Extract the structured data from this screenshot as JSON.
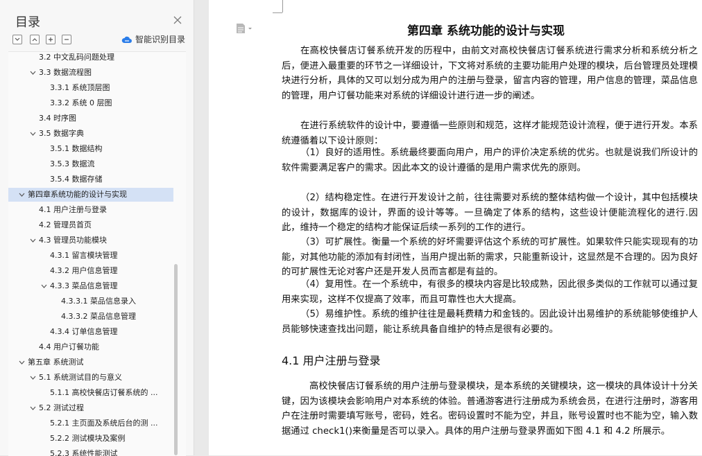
{
  "sidebar": {
    "title": "目录",
    "smart_toc_label": "智能识别目录",
    "items": [
      {
        "label": "3.2 中文乱码问题处理",
        "level": 2,
        "arrow": false,
        "selected": false
      },
      {
        "label": "3.3 数据流程图",
        "level": 2,
        "arrow": true,
        "selected": false
      },
      {
        "label": "3.3.1 系统顶层图",
        "level": 3,
        "arrow": false,
        "selected": false
      },
      {
        "label": "3.3.2 系统 0 层图",
        "level": 3,
        "arrow": false,
        "selected": false
      },
      {
        "label": "3.4 时序图",
        "level": 2,
        "arrow": false,
        "selected": false
      },
      {
        "label": "3.5  数据字典",
        "level": 2,
        "arrow": true,
        "selected": false
      },
      {
        "label": "3.5.1  数据结构",
        "level": 3,
        "arrow": false,
        "selected": false
      },
      {
        "label": "3.5.3  数据流",
        "level": 3,
        "arrow": false,
        "selected": false
      },
      {
        "label": "3.5.4 数据存储",
        "level": 3,
        "arrow": false,
        "selected": false
      },
      {
        "label": "第四章系统功能的设计与实现",
        "level": 1,
        "arrow": true,
        "selected": true
      },
      {
        "label": "4.1 用户注册与登录",
        "level": 2,
        "arrow": false,
        "selected": false
      },
      {
        "label": "4.2 管理员首页",
        "level": 2,
        "arrow": false,
        "selected": false
      },
      {
        "label": "4.3 管理员功能模块",
        "level": 2,
        "arrow": true,
        "selected": false
      },
      {
        "label": "4.3.1 留言模块管理",
        "level": 3,
        "arrow": false,
        "selected": false
      },
      {
        "label": "4.3.2 用户信息管理",
        "level": 3,
        "arrow": false,
        "selected": false
      },
      {
        "label": "4.3.3 菜品信息管理",
        "level": 3,
        "arrow": true,
        "selected": false
      },
      {
        "label": "4.3.3.1 菜品信息录入",
        "level": 4,
        "arrow": false,
        "selected": false
      },
      {
        "label": "4.3.3.2 菜品信息管理",
        "level": 4,
        "arrow": false,
        "selected": false
      },
      {
        "label": "4.3.4 订单信息管理",
        "level": 3,
        "arrow": false,
        "selected": false
      },
      {
        "label": "4.4 用户订餐功能",
        "level": 2,
        "arrow": false,
        "selected": false
      },
      {
        "label": "第五章  系统测试",
        "level": 1,
        "arrow": true,
        "selected": false
      },
      {
        "label": "5.1 系统测试目的与意义",
        "level": 2,
        "arrow": true,
        "selected": false
      },
      {
        "label": "5.1.1  高校快餐店订餐系统的 ...",
        "level": 3,
        "arrow": false,
        "selected": false
      },
      {
        "label": "5.2 测试过程",
        "level": 2,
        "arrow": true,
        "selected": false
      },
      {
        "label": "5.2.1 主页面及系统后台的测 ...",
        "level": 3,
        "arrow": false,
        "selected": false
      },
      {
        "label": "5.2.2 测试模块及案例",
        "level": 3,
        "arrow": false,
        "selected": false
      },
      {
        "label": "5.2.3 系统性能测试",
        "level": 3,
        "arrow": false,
        "selected": false
      }
    ]
  },
  "document": {
    "chapter_title": "第四章  系统功能的设计与实现",
    "paragraphs": [
      "在高校快餐店订餐系统开发的历程中，由前文对高校快餐店订餐系统进行需求分析和系统分析之后，便进入最重要的环节之一详细设计，下文将对系统的主要功能用户处理的模块，后台管理员处理模块进行分析，具体的又可以划分成为用户的注册与登录，留言内容的管理，用户信息的管理，菜品信息的管理，用户订餐功能来对系统的详细设计进行进一步的阐述。",
      "在进行系统软件的设计中，要遵循一些原则和规范，这样才能规范设计流程，便于进行开发。本系统遵循着以下设计原则：",
      "（1）良好的适用性。系统最终要面向用户，用户的评价决定系统的优劣。也就是说我们所设计的软件需要满足客户的需求。因此本文的设计遵循的是用户需求优先的原则。",
      "（2）结构稳定性。在进行开发设计之前，往往需要对系统的整体结构做一个设计，其中包括模块的设计，数据库的设计，界面的设计等等。一旦确定了体系的结构，这些设计便能流程化的进行.因此，维持一个稳定的结构才能保证后续一系列的工作的进行。",
      "（3）可扩展性。衡量一个系统的好坏需要评估这个系统的可扩展性。如果软件只能实现现有的功能，对其他功能的添加有封闭性，当用户提出新的需求，只能重新设计，这显然是不合理的。因为良好的可扩展性无论对客户还是开发人员而言都是有益的。",
      "（4）复用性。在一个系统中，有很多的模块内容是比较成熟，因此很多类似的工作就可以通过复用来实现，这样不仅提高了效率，而且可靠性也大大提高。",
      "（5）易维护性。系统的维护往往是最耗费精力和金钱的。因此设计出易维护的系统能够使维护人员能够快速查找出问题，能让系统具备自维护的特点是很有必要的。"
    ],
    "section_heading": "4.1 用户注册与登录",
    "section_paragraph": "高校快餐店订餐系统的用户注册与登录模块，是本系统的关键模块，这一模块的具体设计十分关键，因为该模块会影响用户对本系统的体验。普通游客进行注册成为系统会员，在进行注册时，游客用户在注册时需要填写账号，密码，姓名。密码设置时不能为空，并且，账号设置时也不能为空，输入数据通过 check1()来衡量是否可以录入。具体的用户注册与登录界面如下图 4.1 和 4.2 所展示。"
  }
}
